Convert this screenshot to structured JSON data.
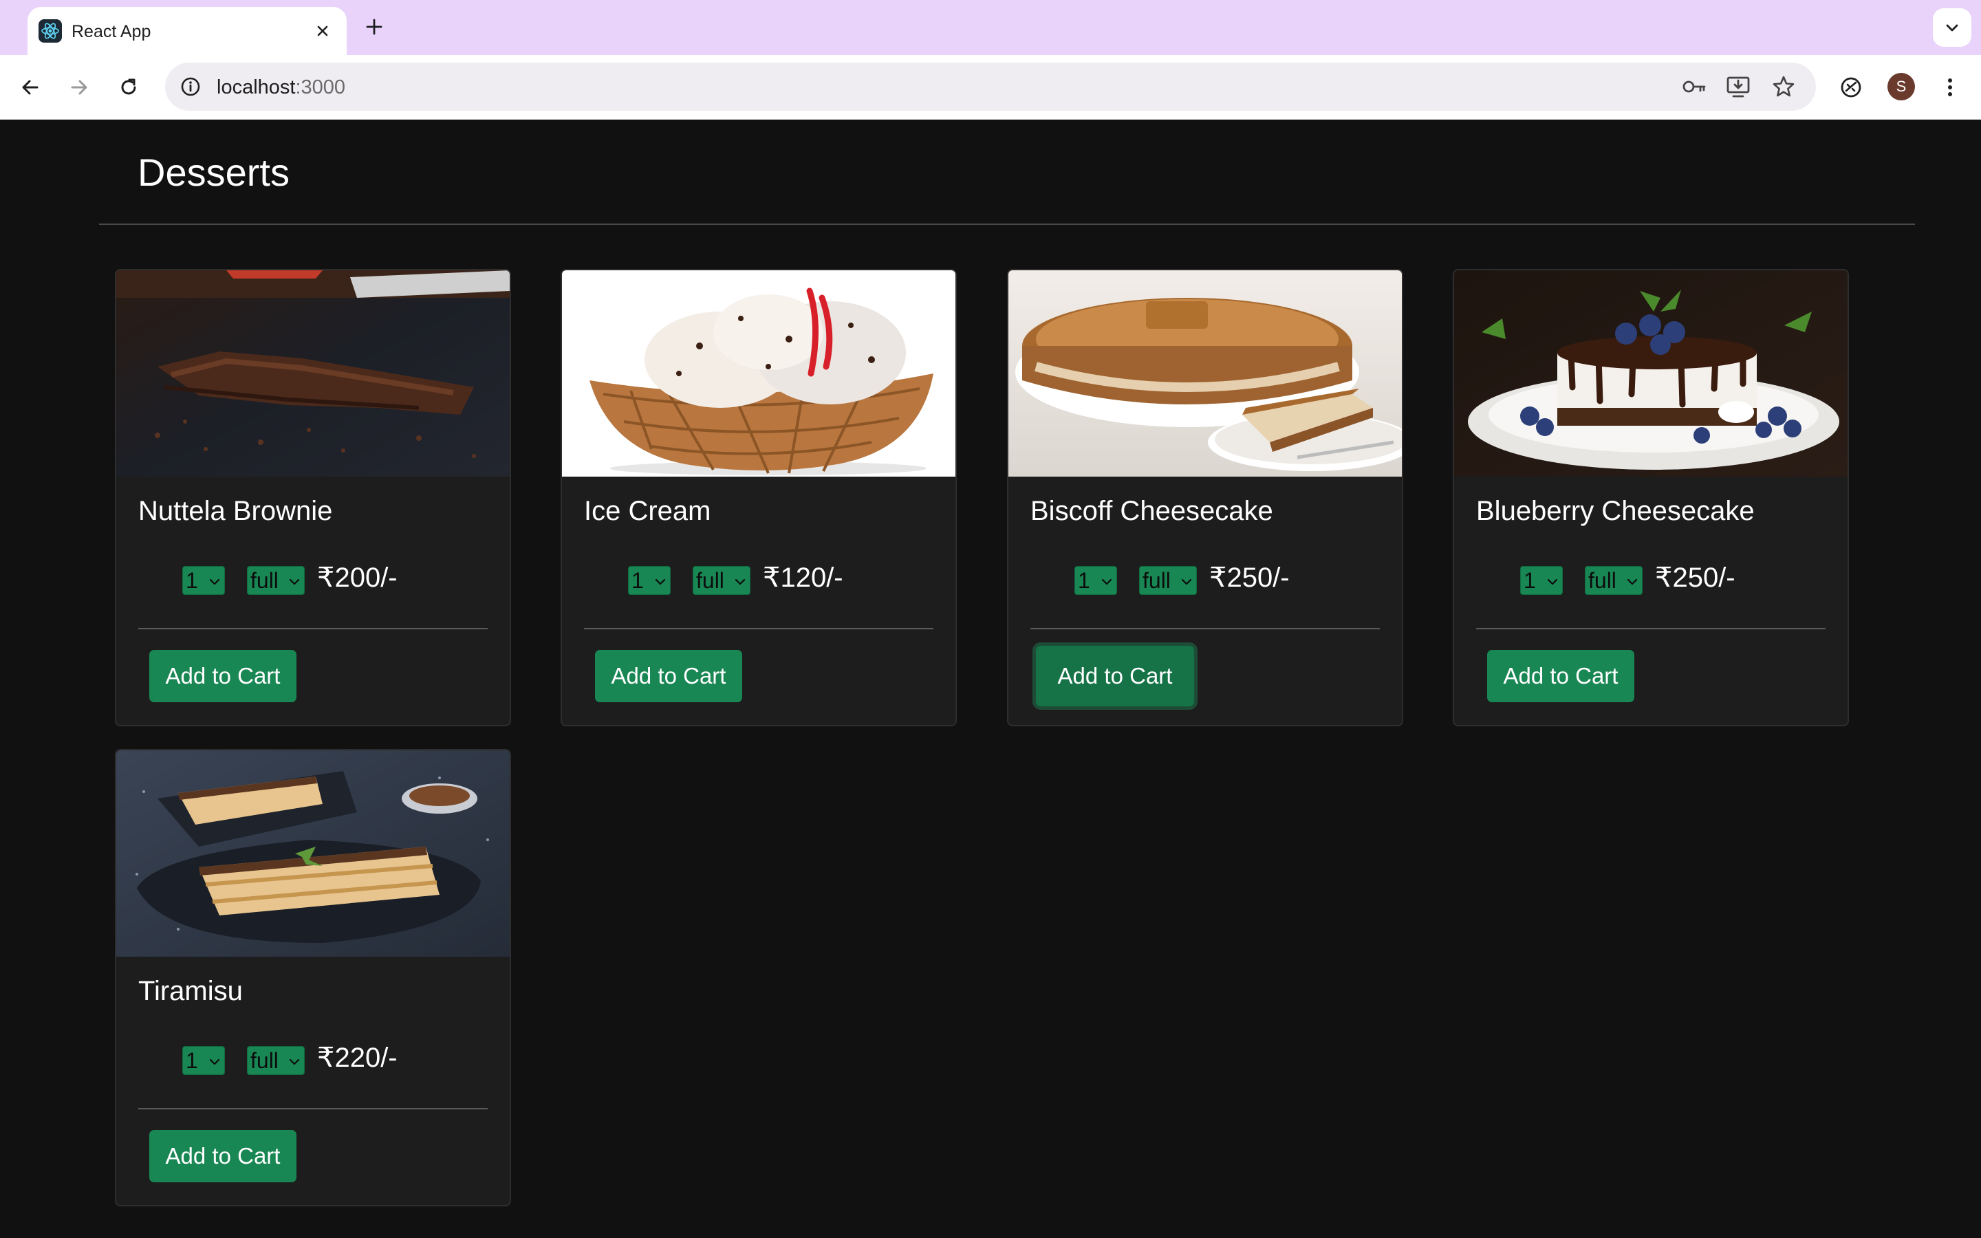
{
  "browser": {
    "tab_title": "React App",
    "url_host": "localhost",
    "url_port": ":3000",
    "avatar_initial": "S",
    "accent": "#e9d3fb"
  },
  "page": {
    "title": "Desserts",
    "button_color": "#198754"
  },
  "items": [
    {
      "name": "Nuttela Brownie",
      "qty": "1",
      "size": "full",
      "price": "₹200/-",
      "button": "Add to Cart"
    },
    {
      "name": "Ice Cream",
      "qty": "1",
      "size": "full",
      "price": "₹120/-",
      "button": "Add to Cart"
    },
    {
      "name": "Biscoff Cheesecake",
      "qty": "1",
      "size": "full",
      "price": "₹250/-",
      "button": "Add to Cart"
    },
    {
      "name": "Blueberry Cheesecake",
      "qty": "1",
      "size": "full",
      "price": "₹250/-",
      "button": "Add to Cart"
    },
    {
      "name": "Tiramisu",
      "qty": "1",
      "size": "full",
      "price": "₹220/-",
      "button": "Add to Cart"
    }
  ],
  "icons": {
    "favicon": "react-logo-icon",
    "tab_close": "close-icon",
    "new_tab": "plus-icon",
    "tab_menu": "chevron-down-icon",
    "back": "arrow-left-icon",
    "forward": "arrow-right-icon",
    "reload": "reload-icon",
    "site_info": "info-icon",
    "passwords": "key-icon",
    "install": "install-app-icon",
    "bookmark": "star-icon",
    "extension": "extension-icon",
    "menu": "kebab-menu-icon"
  }
}
